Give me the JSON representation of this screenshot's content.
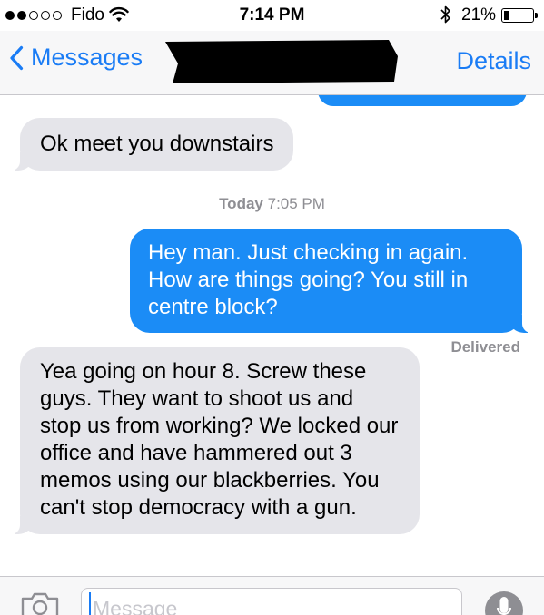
{
  "status_bar": {
    "carrier": "Fido",
    "time": "7:14 PM",
    "battery_percent": "21%",
    "battery_level": 0.21,
    "signal_bars_filled": 2,
    "signal_bars_total": 5,
    "icons": [
      "wifi-icon",
      "bluetooth-icon",
      "battery-icon"
    ]
  },
  "nav": {
    "back_label": "Messages",
    "details_label": "Details",
    "contact_name_redacted": true
  },
  "conversation": {
    "messages": [
      {
        "direction": "received",
        "text": "Ok meet you downstairs"
      },
      {
        "direction": "sent",
        "text": "Hey man. Just checking in again. How are things going? You still in centre block?"
      },
      {
        "direction": "received",
        "text": "Yea going on hour 8. Screw these guys. They want to shoot us and stop us from working? We locked our office and have hammered out 3 memos using our blackberries. You can't stop democracy with a gun."
      }
    ],
    "timestamp_day": "Today",
    "timestamp_time": "7:05 PM",
    "delivery_status": "Delivered"
  },
  "input_bar": {
    "placeholder": "Message"
  },
  "colors": {
    "accent": "#1a7cf5",
    "sent_bubble": "#1b8cf6",
    "received_bubble": "#e5e5ea",
    "meta_text": "#8e8e93"
  }
}
